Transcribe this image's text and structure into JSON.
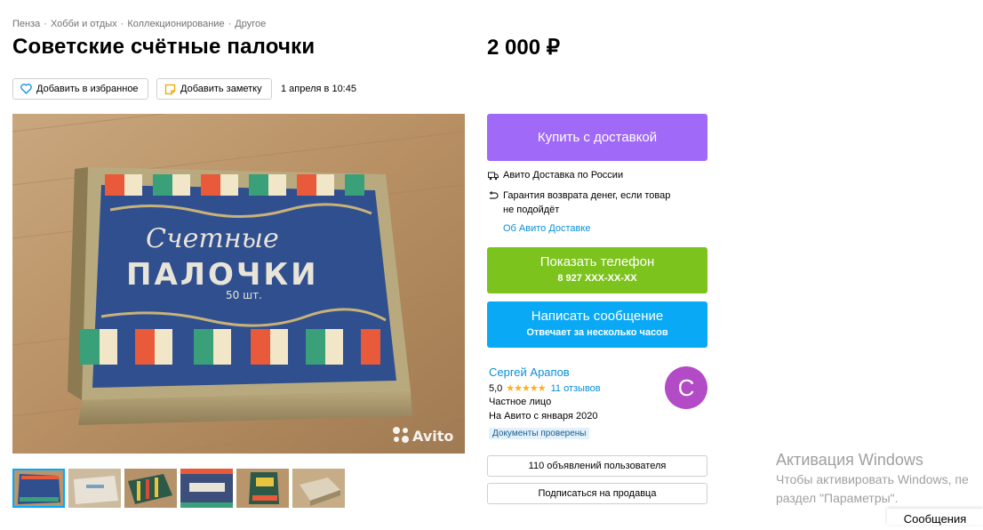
{
  "breadcrumbs": [
    "Пенза",
    "Хобби и отдых",
    "Коллекционирование",
    "Другое"
  ],
  "listing": {
    "title": "Советские счётные палочки",
    "price": "2 000 ₽",
    "date": "1 апреля в 10:45"
  },
  "actions": {
    "favorite_label": "Добавить в избранное",
    "note_label": "Добавить заметку"
  },
  "photo": {
    "box_line1": "Счетные",
    "box_line2": "ПАЛОЧКИ",
    "box_count": "50 шт.",
    "watermark": "Avito",
    "thumbnail_count": 6,
    "selected_thumbnail": 0
  },
  "purchase": {
    "buy_label": "Купить с доставкой",
    "delivery_text": "Авито Доставка по России",
    "guarantee_line1": "Гарантия возврата денег, если товар",
    "guarantee_line2": "не подойдёт",
    "about_link": "Об Авито Доставке"
  },
  "contact": {
    "phone_label": "Показать телефон",
    "phone_number": "8 927 XXX-XX-XX",
    "message_label": "Написать сообщение",
    "message_sub": "Отвечает за несколько часов"
  },
  "seller": {
    "name": "Сергей Арапов",
    "rating": "5,0",
    "stars": "★★★★★",
    "reviews": "11 отзывов",
    "type": "Частное лицо",
    "since": "На Авито с января 2020",
    "badge": "Документы проверены",
    "avatar_letter": "С"
  },
  "seller_actions": {
    "ads_label": "110 объявлений пользователя",
    "subscribe_label": "Подписаться на продавца"
  },
  "windows_activation": {
    "title": "Активация Windows",
    "line1": "Чтобы активировать Windows, пе",
    "line2": "раздел \"Параметры\"."
  },
  "messages_bar": "Сообщения",
  "colors": {
    "buy": "#a169f7",
    "phone": "#7dc31e",
    "message": "#0aa9f5",
    "link": "#0a8fd7",
    "avatar": "#b34bc7"
  }
}
